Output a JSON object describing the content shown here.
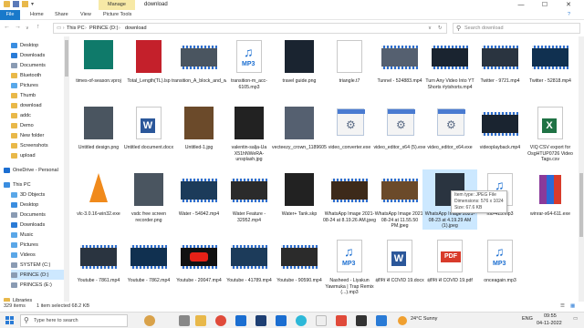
{
  "titlebar": {
    "manage": "Manage",
    "title": "download",
    "minimize": "—",
    "maximize": "☐",
    "close": "✕"
  },
  "ribbon": {
    "tabs": [
      "File",
      "Home",
      "Share",
      "View",
      "Picture Tools"
    ]
  },
  "address": {
    "crumbs": [
      "This PC",
      "PRINCE (D:)",
      "download"
    ],
    "search_placeholder": "Search download"
  },
  "nav": {
    "items": [
      {
        "label": "Desktop",
        "color": "#3a8de0"
      },
      {
        "label": "Downloads",
        "color": "#2a7bd6"
      },
      {
        "label": "Documents",
        "color": "#8a9bb3"
      },
      {
        "label": "Bluetooth",
        "color": "#e8b84a"
      },
      {
        "label": "Pictures",
        "color": "#5aa7e8"
      },
      {
        "label": "Thumb",
        "color": "#e8b84a"
      },
      {
        "label": "download",
        "color": "#e8b84a"
      },
      {
        "label": "addc",
        "color": "#e8b84a"
      },
      {
        "label": "Demo",
        "color": "#e8b84a"
      },
      {
        "label": "New folder",
        "color": "#e8b84a"
      },
      {
        "label": "Screenshots",
        "color": "#e8b84a"
      },
      {
        "label": "upload",
        "color": "#e8b84a"
      },
      {
        "label": "OneDrive - Personal",
        "color": "#1b6ed1"
      },
      {
        "label": "This PC",
        "color": "#3a8de0"
      },
      {
        "label": "3D Objects",
        "color": "#5aa7e8"
      },
      {
        "label": "Desktop",
        "color": "#3a8de0"
      },
      {
        "label": "Documents",
        "color": "#8a9bb3"
      },
      {
        "label": "Downloads",
        "color": "#2a7bd6"
      },
      {
        "label": "Music",
        "color": "#5aa7e8"
      },
      {
        "label": "Pictures",
        "color": "#5aa7e8"
      },
      {
        "label": "Videos",
        "color": "#5aa7e8"
      },
      {
        "label": "SYSTEM (C:)",
        "color": "#8a9bb3"
      },
      {
        "label": "PRINCE (D:)",
        "color": "#8a9bb3"
      },
      {
        "label": "PRINCES (E:)",
        "color": "#8a9bb3"
      },
      {
        "label": "Libraries",
        "color": "#e8b84a"
      }
    ]
  },
  "files": [
    {
      "label": "times-of-season.vproj",
      "kind": "vproj"
    },
    {
      "label": "Total_Length(TL).lsp",
      "kind": "lsp"
    },
    {
      "label": "transition_A_block_and_white.mp4",
      "kind": "video"
    },
    {
      "label": "transition-m_acc-6105.mp3",
      "kind": "mp3"
    },
    {
      "label": "travel guide.png",
      "kind": "img"
    },
    {
      "label": "triangle.t7",
      "kind": "blank"
    },
    {
      "label": "Tunnel - 524883.mp4",
      "kind": "video"
    },
    {
      "label": "Turn Any Video Into YT Shorts #ytshorts.mp4",
      "kind": "video"
    },
    {
      "label": "Twitter - 9721.mp4",
      "kind": "video"
    },
    {
      "label": "Twitter - 52818.mp4",
      "kind": "video"
    },
    {
      "label": "Untitled design.png",
      "kind": "img"
    },
    {
      "label": "Untitled document.docx",
      "kind": "docx"
    },
    {
      "label": "Untitled-1.jpg",
      "kind": "img"
    },
    {
      "label": "valentin-salja-Ua X51hNWeRA-unsplash.jpg",
      "kind": "img"
    },
    {
      "label": "vecteezy_crown_1189605.png",
      "kind": "img"
    },
    {
      "label": "video_converter.exe",
      "kind": "exe"
    },
    {
      "label": "video_editor_x64 (5).exe",
      "kind": "exe"
    },
    {
      "label": "video_editor_x64.exe",
      "kind": "exe"
    },
    {
      "label": "videoplayback.mp4",
      "kind": "video"
    },
    {
      "label": "VIQ CSV export for OsgHTUP0726 Video Tags.csv",
      "kind": "xlsx"
    },
    {
      "label": "vlc-3.0.16-win32.exe",
      "kind": "vlc"
    },
    {
      "label": "vsdc free screen recorder.png",
      "kind": "img"
    },
    {
      "label": "Water - 54942.mp4",
      "kind": "video"
    },
    {
      "label": "Water Feature - 32952.mp4",
      "kind": "video"
    },
    {
      "label": "Water+ Tank.skp",
      "kind": "img"
    },
    {
      "label": "WhatsApp Image 2021-08-24 at 8.19.26 AM.jpeg",
      "kind": "video"
    },
    {
      "label": "WhatsApp Image 2021-08-24 at 11.55.50 PM.jpeg",
      "kind": "video"
    },
    {
      "label": "WhatsApp Image 2021-08-23 at 4.19.29 AM (1).jpeg",
      "kind": "img",
      "selected": true
    },
    {
      "label": "rtio-415.mp3",
      "kind": "mp3"
    },
    {
      "label": "winrar-x64-611.exe",
      "kind": "rar"
    },
    {
      "label": "Youtube - 7861.mp4",
      "kind": "video"
    },
    {
      "label": "Youtube - 7862.mp4",
      "kind": "video"
    },
    {
      "label": "Youtube - 20047.mp4",
      "kind": "yt"
    },
    {
      "label": "Youtube - 41789.mp4",
      "kind": "video"
    },
    {
      "label": "Youtube - 90590.mp4",
      "kind": "video"
    },
    {
      "label": "Nasheed - Liyakun Yawmuka | Trap Remix (...).mp3",
      "kind": "mp3"
    },
    {
      "label": "क्षत्रिय से COVID 19.docx",
      "kind": "docx"
    },
    {
      "label": "क्षत्रिय से COVID 19.pdf",
      "kind": "pdf"
    },
    {
      "label": "onceagain.mp3",
      "kind": "mp3"
    }
  ],
  "tooltip": {
    "line1": "Item type: JPEG File",
    "line2": "Dimensions: 576 x 1024",
    "line3": "Size: 67.6 KB"
  },
  "status": {
    "count": "329 items",
    "selection": "1 item selected  68.2 KB"
  },
  "taskbar": {
    "search_placeholder": "Type here to search",
    "weather": "24°C  Sunny",
    "lang": "ENG",
    "time": "09:55",
    "date": "04-11-2022"
  }
}
